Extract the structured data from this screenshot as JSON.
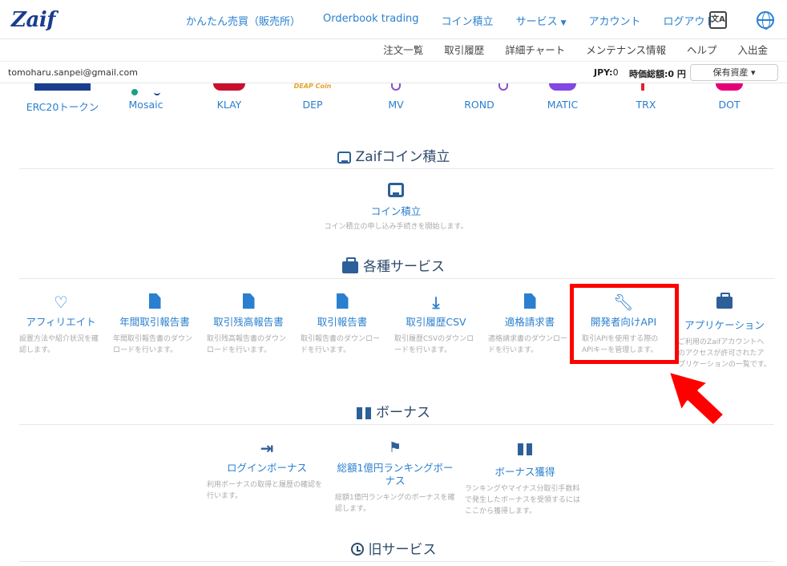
{
  "header": {
    "logo": "Zaif",
    "nav": [
      {
        "label": "かんたん売買（販売所）"
      },
      {
        "label": "Orderbook trading"
      },
      {
        "label": "コイン積立"
      },
      {
        "label": "サービス"
      },
      {
        "label": "アカウント"
      },
      {
        "label": "ログアウト"
      }
    ],
    "translate_icon_text": "文A"
  },
  "subnav": [
    "注文一覧",
    "取引履歴",
    "詳細チャート",
    "メンテナンス情報",
    "ヘルプ",
    "入出金"
  ],
  "userbar": {
    "email": "tomoharu.sanpei@gmail.com",
    "jpy_label": "JPY:",
    "jpy_value": "0",
    "total_label": "時価総額:",
    "total_value": "0 円",
    "assets_button": "保有資産 ▾"
  },
  "coins": [
    "ERC20トークン",
    "Mosaic",
    "KLAY",
    "DEP",
    "MV",
    "ROND",
    "MATIC",
    "TRX",
    "DOT"
  ],
  "coin_logo_text": {
    "dep": "DEAP Coin"
  },
  "tsumitate": {
    "title": "Zaifコイン積立",
    "item_label": "コイン積立",
    "item_desc": "コイン積立の申し込み手続きを開始します。"
  },
  "services": {
    "title": "各種サービス",
    "items": [
      {
        "label": "アフィリエイト",
        "desc": "設置方法や紹介状況を確認します。"
      },
      {
        "label": "年間取引報告書",
        "desc": "年間取引報告書のダウンロードを行います。"
      },
      {
        "label": "取引残高報告書",
        "desc": "取引残高報告書のダウンロードを行います。"
      },
      {
        "label": "取引報告書",
        "desc": "取引報告書のダウンロードを行います。"
      },
      {
        "label": "取引履歴CSV",
        "desc": "取引履歴CSVのダウンロードを行います。"
      },
      {
        "label": "適格請求書",
        "desc": "適格請求書のダウンロードを行います。"
      },
      {
        "label": "開発者向けAPI",
        "desc": "取引APIを使用する際のAPIキーを管理します。"
      },
      {
        "label": "アプリケーション",
        "desc": "ご利用のZaifアカウントへのアクセスが許可されたアプリケーションの一覧です。"
      }
    ]
  },
  "bonus": {
    "title": "ボーナス",
    "items": [
      {
        "label": "ログインボーナス",
        "desc": "利用ボーナスの取得と履歴の確認を行います。"
      },
      {
        "label": "総額1億円ランキングボーナス",
        "desc": "総額1億円ランキングのボーナスを確認します。"
      },
      {
        "label": "ボーナス獲得",
        "desc": "ランキングやマイナス分取引手数料で発生したボーナスを受領するにはここから獲得します。"
      }
    ]
  },
  "old_services": {
    "title": "旧サービス"
  },
  "colors": {
    "link": "#2a7fcf",
    "heading": "#2d4a6b",
    "highlight": "#ff0000"
  }
}
